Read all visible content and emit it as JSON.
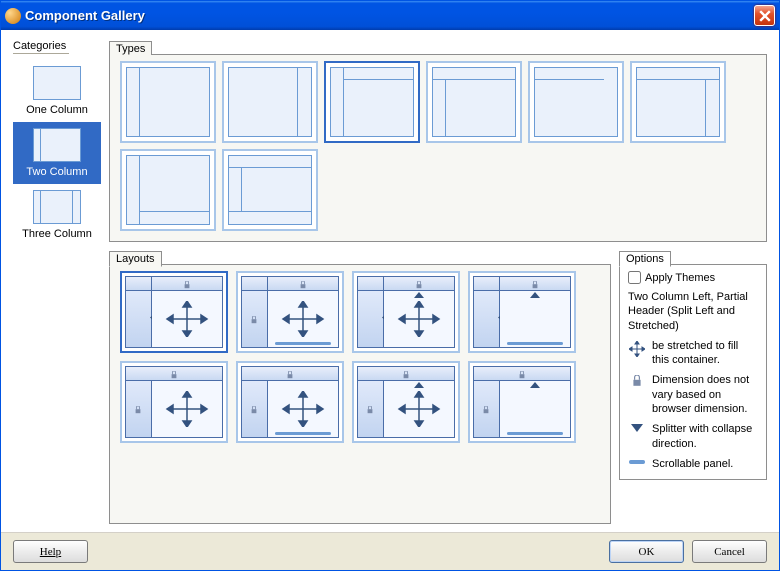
{
  "titlebar": {
    "title": "Component Gallery"
  },
  "categories": {
    "label": "Categories",
    "items": [
      {
        "label": "One Column"
      },
      {
        "label": "Two Column"
      },
      {
        "label": "Three Column"
      }
    ],
    "selected_index": 1
  },
  "types": {
    "label": "Types",
    "selected_index": 2,
    "count": 8
  },
  "layouts": {
    "label": "Layouts",
    "selected_index": 0,
    "count": 8
  },
  "options": {
    "label": "Options",
    "apply_themes_label": "Apply Themes",
    "apply_themes_checked": false,
    "description": "Two Column Left, Partial Header (Split Left and Stretched)",
    "legend": {
      "stretch": "be stretched to fill this container.",
      "lock": "Dimension does not vary based on browser dimension.",
      "splitter": "Splitter with collapse direction.",
      "scroll": "Scrollable panel."
    }
  },
  "footer": {
    "help": "Help",
    "ok": "OK",
    "cancel": "Cancel"
  }
}
